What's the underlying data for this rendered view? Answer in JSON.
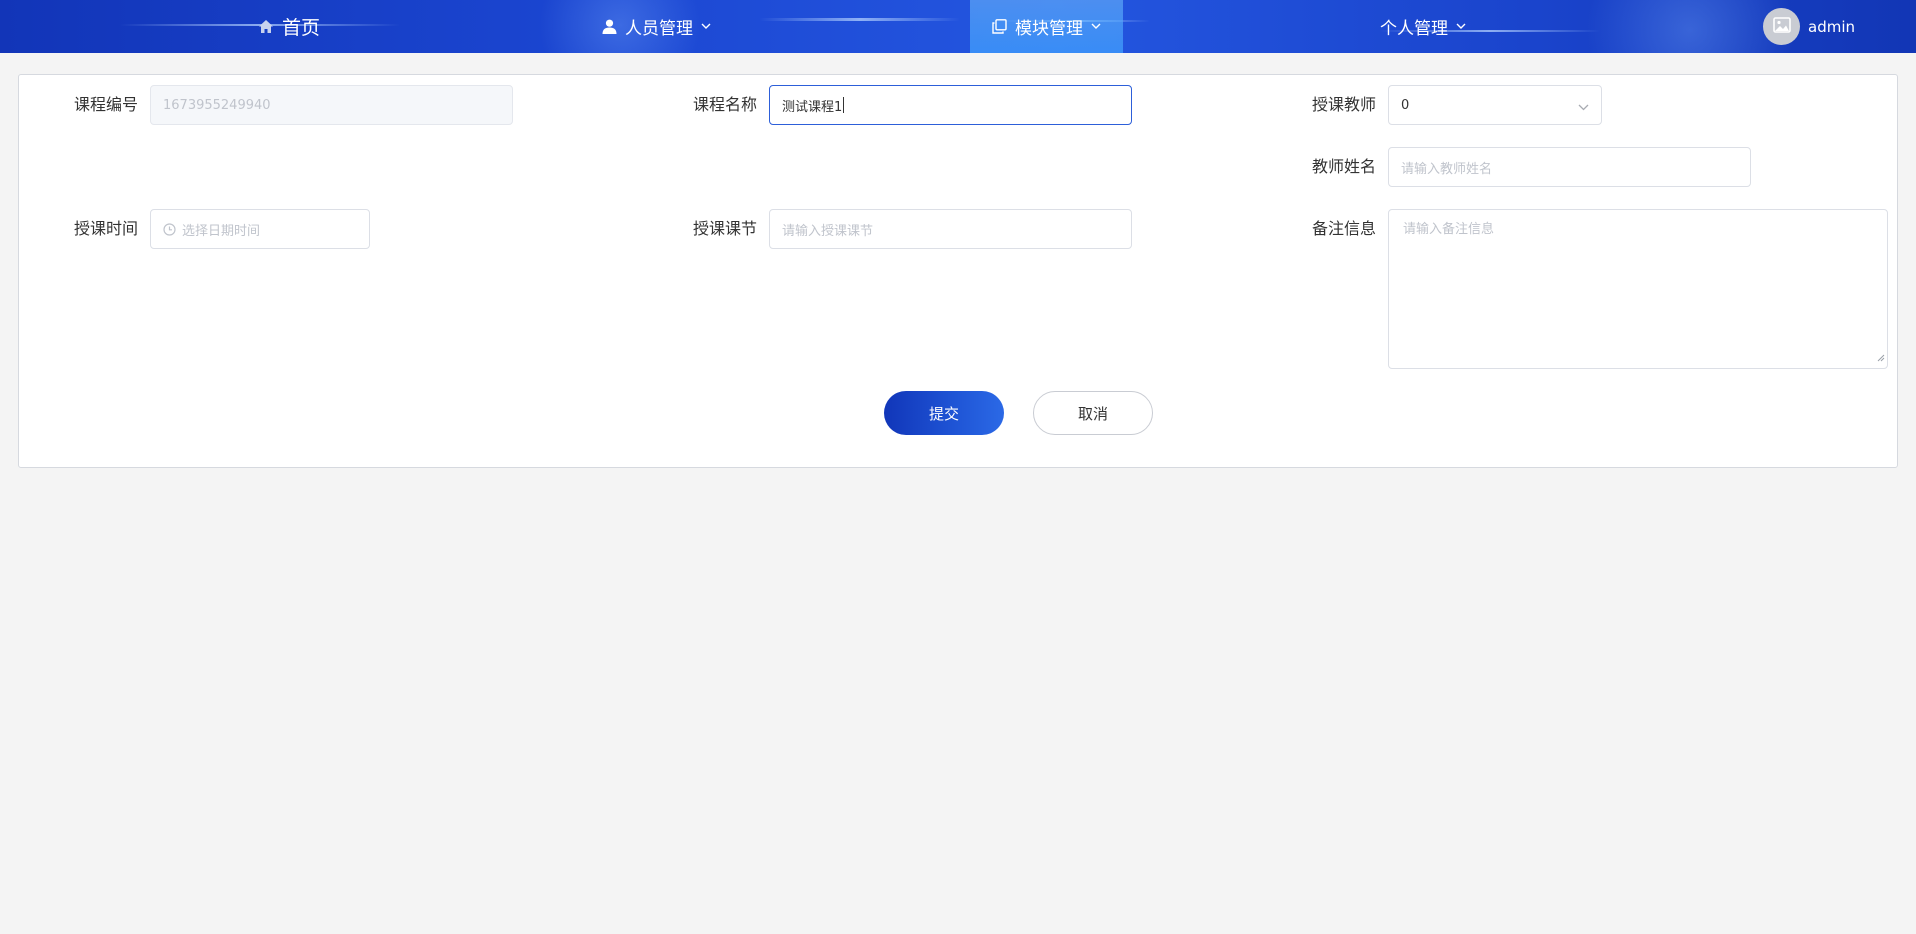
{
  "nav": {
    "home": {
      "label": "首页"
    },
    "personnel": {
      "label": "人员管理"
    },
    "modules": {
      "label": "模块管理"
    },
    "personal": {
      "label": "个人管理"
    },
    "user": {
      "name": "admin"
    }
  },
  "form": {
    "course_id": {
      "label": "课程编号",
      "value": "1673955249940"
    },
    "course_name": {
      "label": "课程名称",
      "value": "测试课程1"
    },
    "teacher": {
      "label": "授课教师",
      "value": "0"
    },
    "teacher_name": {
      "label": "教师姓名",
      "placeholder": "请输入教师姓名"
    },
    "time": {
      "label": "授课时间",
      "placeholder": "选择日期时间"
    },
    "section": {
      "label": "授课课节",
      "placeholder": "请输入授课课节"
    },
    "remark": {
      "label": "备注信息",
      "placeholder": "请输入备注信息"
    },
    "submit_label": "提交",
    "cancel_label": "取消"
  },
  "colors": {
    "nav_bg": "#1b46d1",
    "nav_active": "#4aa6f5",
    "primary": "#1f55d6",
    "focus_border": "#2d5fd9"
  }
}
